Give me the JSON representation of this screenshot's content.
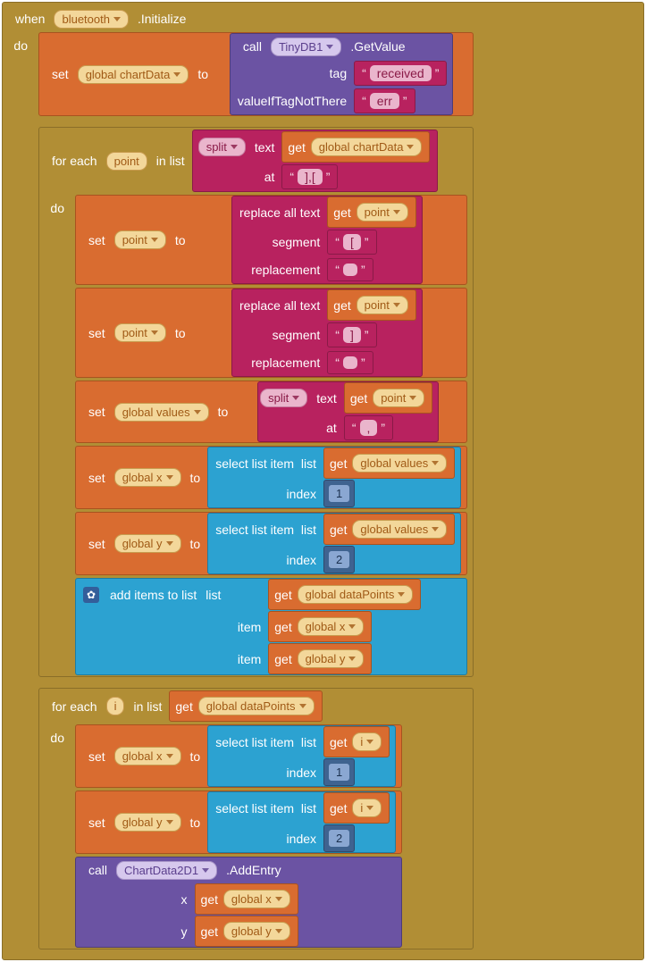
{
  "when": {
    "prefix": "when",
    "component": "bluetooth",
    "event": ".Initialize"
  },
  "do_label": "do",
  "set": "set",
  "to": "to",
  "call": "call",
  "get": "get",
  "forEach": "for each",
  "inList": "in list",
  "vars": {
    "chartData": "global chartData",
    "point": "point",
    "values": "global values",
    "x": "global x",
    "y": "global y",
    "dataPoints": "global dataPoints",
    "i": "i"
  },
  "tinydb": {
    "component": "TinyDB1",
    "method": ".GetValue",
    "args": {
      "tag": "tag",
      "vnt": "valueIfTagNotThere"
    },
    "tagVal": "received",
    "vntVal": "err"
  },
  "text": {
    "split": "split",
    "textLbl": "text",
    "at": "at",
    "replace": "replace all text",
    "segment": "segment",
    "replacement": "replacement",
    "sep1": "],[",
    "lbrack": "[",
    "rbrack": "]",
    "comma": ","
  },
  "list": {
    "select": "select list item",
    "listLbl": "list",
    "index": "index",
    "addItems": "add items to list",
    "item": "item",
    "idx1": "1",
    "idx2": "2"
  },
  "chart2d": {
    "component": "ChartData2D1",
    "method": ".AddEntry",
    "x": "x",
    "y": "y"
  }
}
